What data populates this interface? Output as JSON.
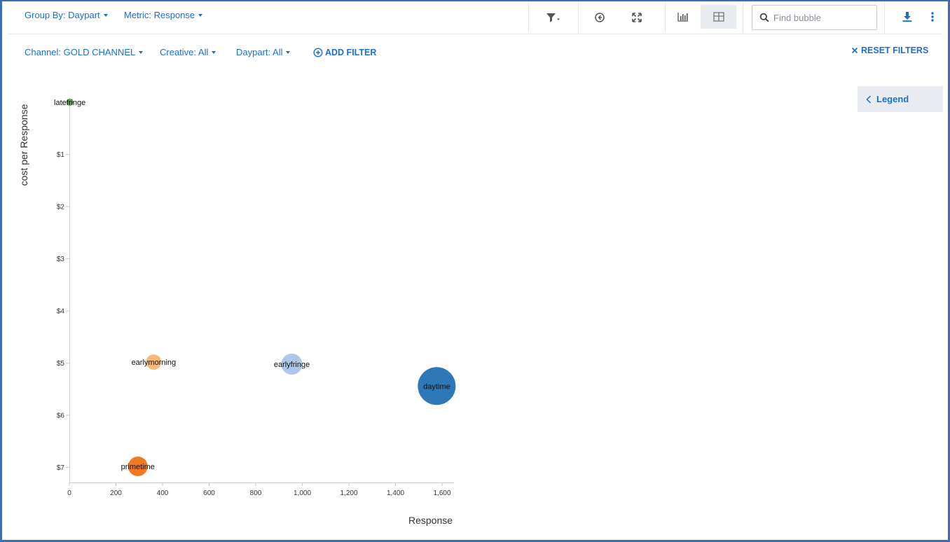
{
  "toolbar": {
    "group_by": "Group By: Daypart",
    "metric": "Metric: Response",
    "search_placeholder": "Find bubble"
  },
  "filters": {
    "channel": "Channel: GOLD CHANNEL",
    "creative": "Creative: All",
    "daypart": "Daypart: All",
    "add_filter": "ADD FILTER",
    "reset": "RESET FILTERS"
  },
  "legend": {
    "label": "Legend"
  },
  "icons": [
    "filter-icon",
    "back-icon",
    "expand-icon",
    "bar-chart-icon",
    "table-view-icon",
    "search-icon",
    "download-icon",
    "more-vertical-icon",
    "plus-circle-icon",
    "close-icon",
    "chevron-left-icon"
  ],
  "colors": {
    "accent": "#1a6fd1",
    "frame": "#3a6fb8"
  },
  "chart_data": {
    "type": "scatter",
    "xlabel": "Response",
    "ylabel": "cost per Response",
    "xlim": [
      0,
      1650
    ],
    "ylim": [
      0,
      7.3
    ],
    "y_inverted": true,
    "x_ticks": [
      "0",
      "200",
      "400",
      "600",
      "800",
      "1,000",
      "1,200",
      "1,400",
      "1,600"
    ],
    "y_ticks": [
      "$1",
      "$2",
      "$3",
      "$4",
      "$5",
      "$6",
      "$7"
    ],
    "points": [
      {
        "label": "latefringe",
        "x": 2,
        "y": 0.0,
        "r": 5,
        "color": "#5aab4f"
      },
      {
        "label": "earlymorning",
        "x": 362,
        "y": 4.98,
        "r": 11,
        "color": "#f7b97a"
      },
      {
        "label": "earlyfringe",
        "x": 955,
        "y": 5.02,
        "r": 15,
        "color": "#aec7e8"
      },
      {
        "label": "daytime",
        "x": 1577,
        "y": 5.44,
        "r": 27,
        "color": "#2f78b8"
      },
      {
        "label": "primetime",
        "x": 294,
        "y": 6.98,
        "r": 14,
        "color": "#f07b22"
      }
    ]
  }
}
